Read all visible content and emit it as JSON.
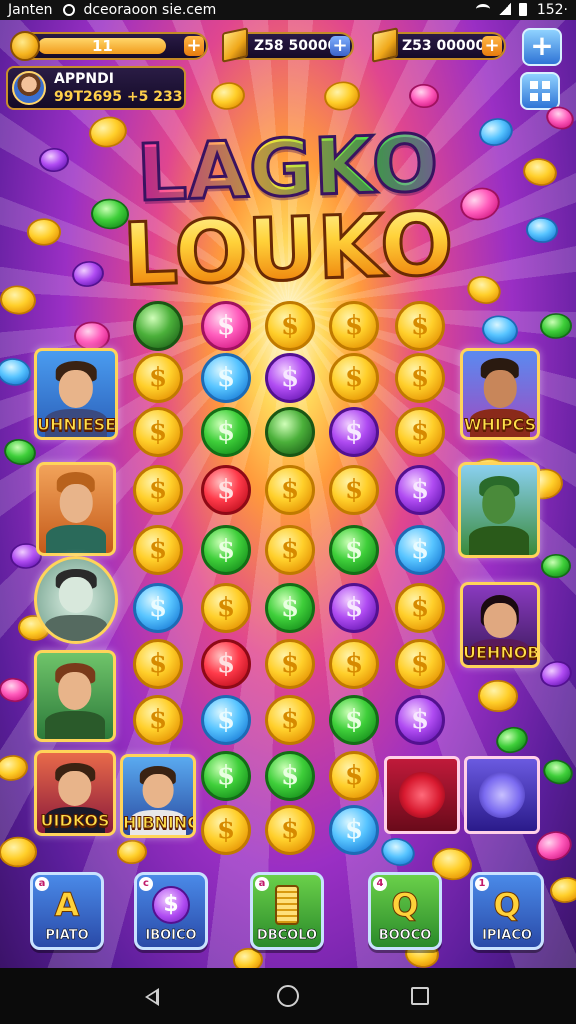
{
  "status_bar": {
    "left_text": "Janten",
    "url": "dceoraoon sie.cem",
    "time": "152·"
  },
  "hud": {
    "level": "11",
    "xp_fraction": 0.85,
    "gold": "Z58 50000",
    "coins": "Z53 00000",
    "plus_icon": "plus-icon",
    "menu_icon": "grid-icon"
  },
  "player": {
    "name": "APPNDI",
    "stats": "99T2695 +5 233"
  },
  "title": {
    "line1": "LAGKO",
    "line2": "LOUKO"
  },
  "coin_symbol": "$",
  "characters": {
    "c1": "UHNIESE",
    "c2": "WHIPCS",
    "c3": "UEHNOB",
    "c4": "UIDKOS",
    "c5": "HIBNING"
  },
  "bottom_buttons": [
    {
      "label": "PIATO",
      "icon": "A",
      "badge": "a"
    },
    {
      "label": "IBOICO",
      "icon": "$",
      "badge": "c"
    },
    {
      "label": "DBCOLO",
      "icon": "",
      "badge": "a"
    },
    {
      "label": "BOOCO",
      "icon": "Q",
      "badge": "4"
    },
    {
      "label": "IPIACO",
      "icon": "Q",
      "badge": "1"
    }
  ],
  "colors": {
    "accent_gold": "#ffd23a",
    "bg_purple": "#5a1e9a",
    "ray": "#ffd75a"
  }
}
